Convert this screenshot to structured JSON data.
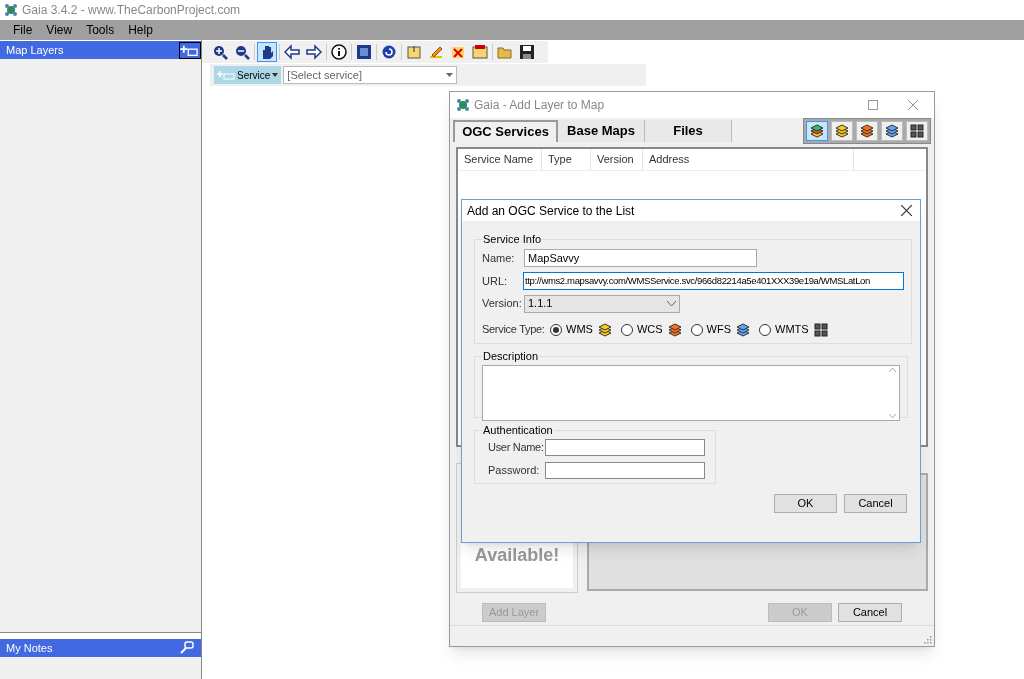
{
  "window": {
    "title": "Gaia 3.4.2 - www.TheCarbonProject.com"
  },
  "menu": [
    "File",
    "View",
    "Tools",
    "Help"
  ],
  "map_layers_panel": {
    "title": "Map Layers"
  },
  "notes_panel": {
    "title": "My Notes"
  },
  "toolbar": [
    {
      "selected": false
    },
    {
      "selected": false
    },
    {
      "selected": true
    },
    {
      "selected": false
    },
    {
      "selected": false
    },
    {
      "selected": false
    },
    {
      "selected": false
    },
    {
      "selected": false
    },
    {
      "selected": false
    },
    {
      "selected": false
    },
    {
      "selected": false
    },
    {
      "selected": false
    },
    {
      "selected": false
    },
    {
      "selected": false
    }
  ],
  "service_bar": {
    "button": "Service",
    "select": "[Select service]"
  },
  "add_layer_dialog": {
    "title": "Gaia - Add Layer to Map",
    "tabs": [
      {
        "label": "OGC Services",
        "selected": true
      },
      {
        "label": "Base Maps",
        "selected": false
      },
      {
        "label": "Files",
        "selected": false
      }
    ],
    "layer_types": [
      {
        "selected": true
      },
      {
        "selected": false
      },
      {
        "selected": false
      },
      {
        "selected": false
      },
      {
        "selected": false
      }
    ],
    "columns": [
      "Service Name",
      "Type",
      "Version",
      "Address"
    ],
    "preview_text": "Available!",
    "buttons": [
      {
        "label": "Add Layer",
        "disabled": true
      },
      {
        "label": "OK",
        "disabled": true
      },
      {
        "label": "Cancel",
        "disabled": false
      }
    ]
  },
  "add_service_dialog": {
    "title": "Add an OGC Service to the List",
    "service_info": {
      "legend": "Service Info",
      "name_label": "Name:",
      "name": "MapSavvy",
      "url_label": "URL:",
      "url": "ttp://wms2.mapsavvy.com/WMSService.svc/966d82214a5e401XXX39e19a/WMSLatLon",
      "version_label": "Version:",
      "version": "1.1.1",
      "type_label": "Service Type:",
      "types": [
        {
          "label": "WMS",
          "selected": true
        },
        {
          "label": "WCS",
          "selected": false
        },
        {
          "label": "WFS",
          "selected": false
        },
        {
          "label": "WMTS",
          "selected": false
        }
      ]
    },
    "description": {
      "legend": "Description"
    },
    "authentication": {
      "legend": "Authentication",
      "user_label": "User Name:",
      "password_label": "Password:"
    },
    "buttons": [
      "OK",
      "Cancel"
    ]
  }
}
